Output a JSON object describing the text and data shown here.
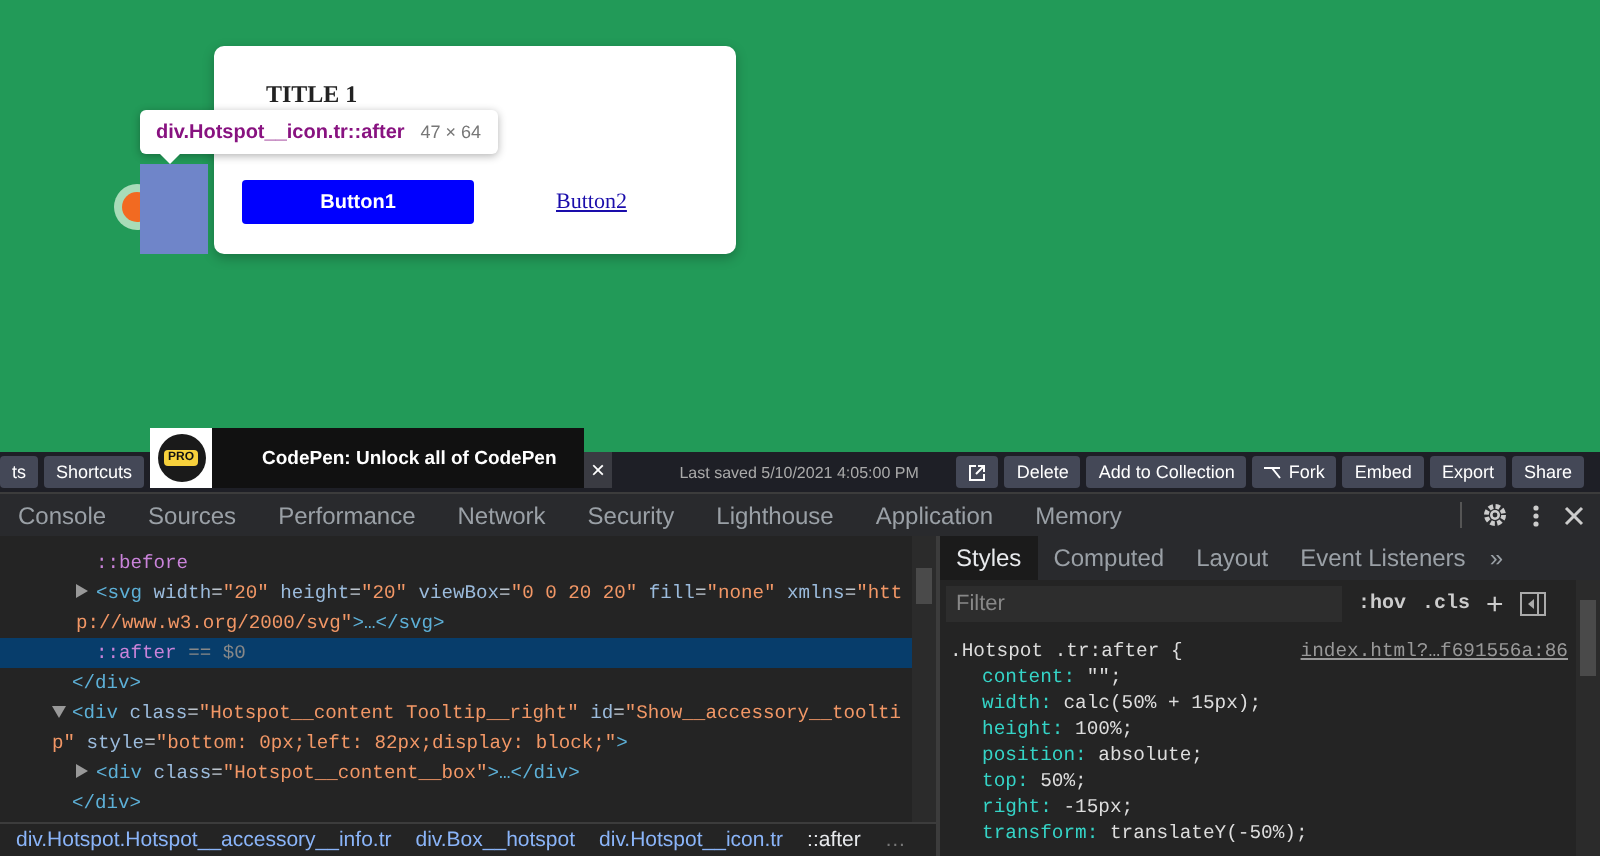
{
  "preview": {
    "card": {
      "title": "TITLE 1",
      "buttons": [
        {
          "label": "Button1",
          "kind": "primary"
        },
        {
          "label": "Button2",
          "kind": "link"
        }
      ]
    },
    "inspect_tooltip": {
      "selector": "div.Hotspot__icon.tr::after",
      "size": "47 × 64"
    }
  },
  "codepen_bar": {
    "left_buttons": [
      "ts",
      "Shortcuts"
    ],
    "promo": {
      "badge": "PRO",
      "text": "CodePen: Unlock all of CodePen",
      "close": "×"
    },
    "last_saved": "Last saved 5/10/2021 4:05:00 PM",
    "buttons": [
      {
        "kind": "external"
      },
      {
        "kind": "text",
        "label": "Delete"
      },
      {
        "kind": "text",
        "label": "Add to Collection"
      },
      {
        "kind": "fork",
        "label": "Fork"
      },
      {
        "kind": "text",
        "label": "Embed"
      },
      {
        "kind": "text",
        "label": "Export"
      },
      {
        "kind": "text",
        "label": "Share"
      }
    ]
  },
  "devtools": {
    "tabs": [
      {
        "label": "Console",
        "selected": false
      },
      {
        "label": "Sources",
        "selected": false
      },
      {
        "label": "Performance",
        "selected": false
      },
      {
        "label": "Network",
        "selected": false
      },
      {
        "label": "Security",
        "selected": false
      },
      {
        "label": "Lighthouse",
        "selected": false
      },
      {
        "label": "Application",
        "selected": false
      },
      {
        "label": "Memory",
        "selected": false
      }
    ],
    "elements": {
      "nodes": [
        {
          "kind": "offscreen",
          "close": "</div>",
          "children": [
            {
              "kind": "pseudo",
              "selected": false,
              "tokens": [
                {
                  "kind": "pseudo",
                  "text": "::before"
                }
              ]
            },
            {
              "kind": "element",
              "selected": false,
              "expanded": false,
              "tokens": [
                {
                  "kind": "tag",
                  "text": "<svg"
                },
                {
                  "kind": "attr",
                  "text": " width"
                },
                {
                  "kind": "punct",
                  "text": "="
                },
                {
                  "kind": "value",
                  "text": "\"20\""
                },
                {
                  "kind": "attr",
                  "text": " height"
                },
                {
                  "kind": "punct",
                  "text": "="
                },
                {
                  "kind": "value",
                  "text": "\"20\""
                },
                {
                  "kind": "attr",
                  "text": " viewBox"
                },
                {
                  "kind": "punct",
                  "text": "="
                },
                {
                  "kind": "value",
                  "text": "\"0 0 20 20\""
                },
                {
                  "kind": "attr",
                  "text": " fill"
                },
                {
                  "kind": "punct",
                  "text": "="
                },
                {
                  "kind": "value",
                  "text": "\"none\""
                },
                {
                  "kind": "attr",
                  "text": " xmlns"
                },
                {
                  "kind": "punct",
                  "text": "="
                },
                {
                  "kind": "value",
                  "text": "\"http://www.w3.org/2000/svg\""
                },
                {
                  "kind": "tag",
                  "text": ">…</svg>"
                }
              ]
            },
            {
              "kind": "pseudo",
              "selected": true,
              "tokens": [
                {
                  "kind": "pseudo",
                  "text": "::after"
                },
                {
                  "kind": "note",
                  "text": " == $0"
                }
              ]
            }
          ]
        },
        {
          "kind": "element",
          "selected": false,
          "expanded": true,
          "close": "</div>",
          "tokens": [
            {
              "kind": "tag",
              "text": "<div"
            },
            {
              "kind": "attr",
              "text": " class"
            },
            {
              "kind": "punct",
              "text": "="
            },
            {
              "kind": "value",
              "text": "\"Hotspot__content Tooltip__right\""
            },
            {
              "kind": "attr",
              "text": " id"
            },
            {
              "kind": "punct",
              "text": "="
            },
            {
              "kind": "value",
              "text": "\"Show__accessory__tooltip\""
            },
            {
              "kind": "attr",
              "text": " style"
            },
            {
              "kind": "punct",
              "text": "="
            },
            {
              "kind": "value",
              "text": "\"bottom: 0px;left: 82px;display: block;\""
            },
            {
              "kind": "tag",
              "text": ">"
            }
          ],
          "children": [
            {
              "kind": "element",
              "selected": false,
              "expanded": false,
              "tokens": [
                {
                  "kind": "tag",
                  "text": "<div"
                },
                {
                  "kind": "attr",
                  "text": " class"
                },
                {
                  "kind": "punct",
                  "text": "="
                },
                {
                  "kind": "value",
                  "text": "\"Hotspot__content__box\""
                },
                {
                  "kind": "tag",
                  "text": ">…</div>"
                }
              ]
            }
          ]
        }
      ]
    },
    "breadcrumbs": [
      {
        "label": "div.Hotspot.Hotspot__accessory__info.tr",
        "selected": false
      },
      {
        "label": "div.Box__hotspot",
        "selected": false
      },
      {
        "label": "div.Hotspot__icon.tr",
        "selected": false
      },
      {
        "label": "::after",
        "selected": true
      }
    ],
    "breadcrumb_more": "…",
    "styles": {
      "tabs": [
        {
          "label": "Styles",
          "selected": true
        },
        {
          "label": "Computed",
          "selected": false
        },
        {
          "label": "Layout",
          "selected": false
        },
        {
          "label": "Event Listeners",
          "selected": false
        }
      ],
      "more_tabs": "»",
      "filter": {
        "placeholder": "Filter"
      },
      "toggles": [
        ":hov",
        ".cls"
      ],
      "add": "+",
      "rule": {
        "selector": ".Hotspot .tr:after {",
        "source": "index.html?…f691556a:86",
        "declarations": [
          {
            "property": "content:",
            "value": "\"\";"
          },
          {
            "property": "width:",
            "value": "calc(50% + 15px);"
          },
          {
            "property": "height:",
            "value": "100%;"
          },
          {
            "property": "position:",
            "value": "absolute;"
          },
          {
            "property": "top:",
            "value": "50%;"
          },
          {
            "property": "right:",
            "value": "-15px;"
          },
          {
            "property": "transform:",
            "value": "translateY(-50%);"
          }
        ]
      }
    }
  }
}
